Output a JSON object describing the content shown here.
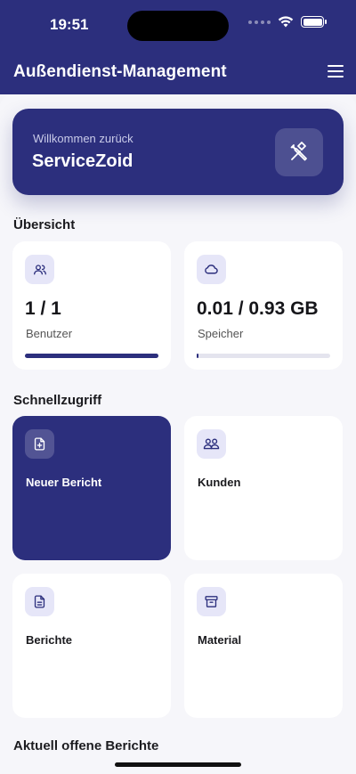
{
  "status": {
    "time": "19:51"
  },
  "header": {
    "title": "Außendienst-Management"
  },
  "welcome": {
    "subtitle": "Willkommen zurück",
    "name": "ServiceZoid"
  },
  "overview": {
    "title": "Übersicht",
    "users": {
      "value": "1 / 1",
      "label": "Benutzer",
      "progress": 1.0,
      "icon": "users-icon"
    },
    "storage": {
      "value": "0.01 / 0.93 GB",
      "label": "Speicher",
      "progress": 0.01,
      "icon": "cloud-icon"
    }
  },
  "quick_access": {
    "title": "Schnellzugriff",
    "items": [
      {
        "label": "Neuer Bericht",
        "icon": "file-plus-icon"
      },
      {
        "label": "Kunden",
        "icon": "customers-icon"
      },
      {
        "label": "Berichte",
        "icon": "file-text-icon"
      },
      {
        "label": "Material",
        "icon": "archive-icon"
      }
    ]
  },
  "open_reports": {
    "title": "Aktuell offene Berichte"
  },
  "colors": {
    "primary": "#2c2f7d",
    "accent_bg": "#e6e6f8"
  }
}
